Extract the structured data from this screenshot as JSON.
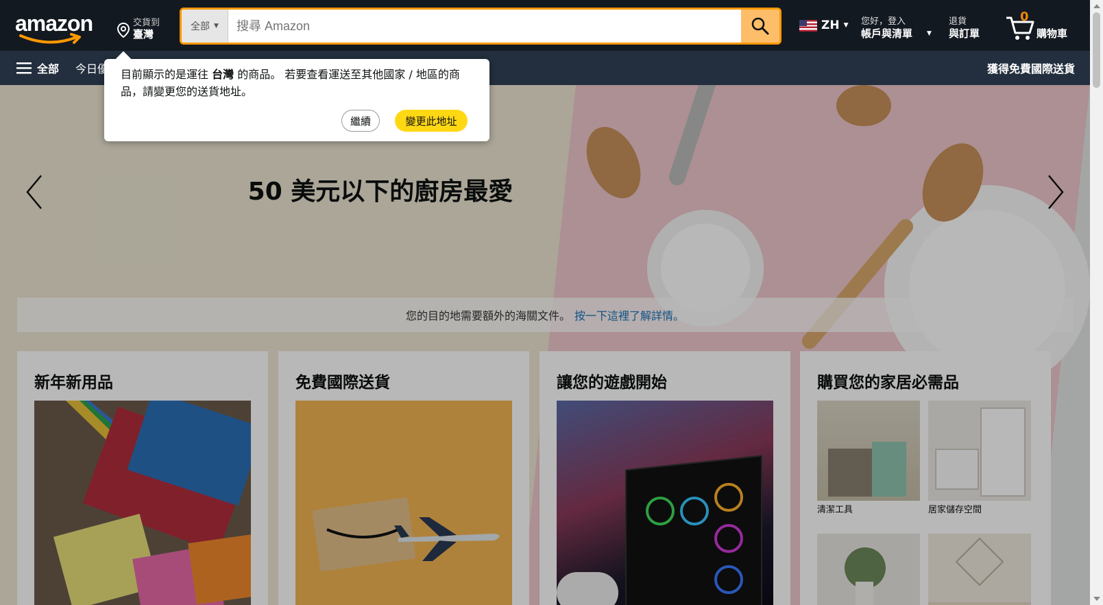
{
  "header": {
    "logo_text": "amazon",
    "deliver": {
      "line1": "交貨到",
      "line2": "臺灣"
    },
    "search": {
      "category": "全部",
      "placeholder": "搜尋 Amazon",
      "value": ""
    },
    "language": "ZH",
    "account": {
      "line1": "您好，登入",
      "line2": "帳戶與清單"
    },
    "orders": {
      "line1": "退貨",
      "line2": "與訂單"
    },
    "cart": {
      "count": "0",
      "label": "購物車"
    }
  },
  "subnav": {
    "all_label": "全部",
    "today_label": "今日優惠",
    "free_shipping_label": "獲得免費國際送貨"
  },
  "popover": {
    "message_part1": "目前顯示的是運往",
    "message_country": "台灣",
    "message_part2": "的商品。 若要查看運送至其他國家 / 地區的商品，請變更您的送貨地址。",
    "continue_label": "繼續",
    "change_label": "變更此地址"
  },
  "hero": {
    "title": "50 美元以下的廚房最愛"
  },
  "customs": {
    "text": "您的目的地需要額外的海關文件。",
    "link": "按一下這裡了解詳情。"
  },
  "cards": [
    {
      "title": "新年新用品"
    },
    {
      "title": "免費國際送貨"
    },
    {
      "title": "讓您的遊戲開始"
    },
    {
      "title": "購買您的家居必需品",
      "items": [
        {
          "caption": "清潔工具"
        },
        {
          "caption": "居家儲存空間"
        },
        {
          "caption": ""
        },
        {
          "caption": ""
        }
      ]
    }
  ],
  "colors": {
    "nav_top": "#131921",
    "nav_sub": "#232f3e",
    "search_border": "#ff9900",
    "search_button": "#febd69",
    "cart_count": "#f08804",
    "primary_button": "#ffd814"
  }
}
